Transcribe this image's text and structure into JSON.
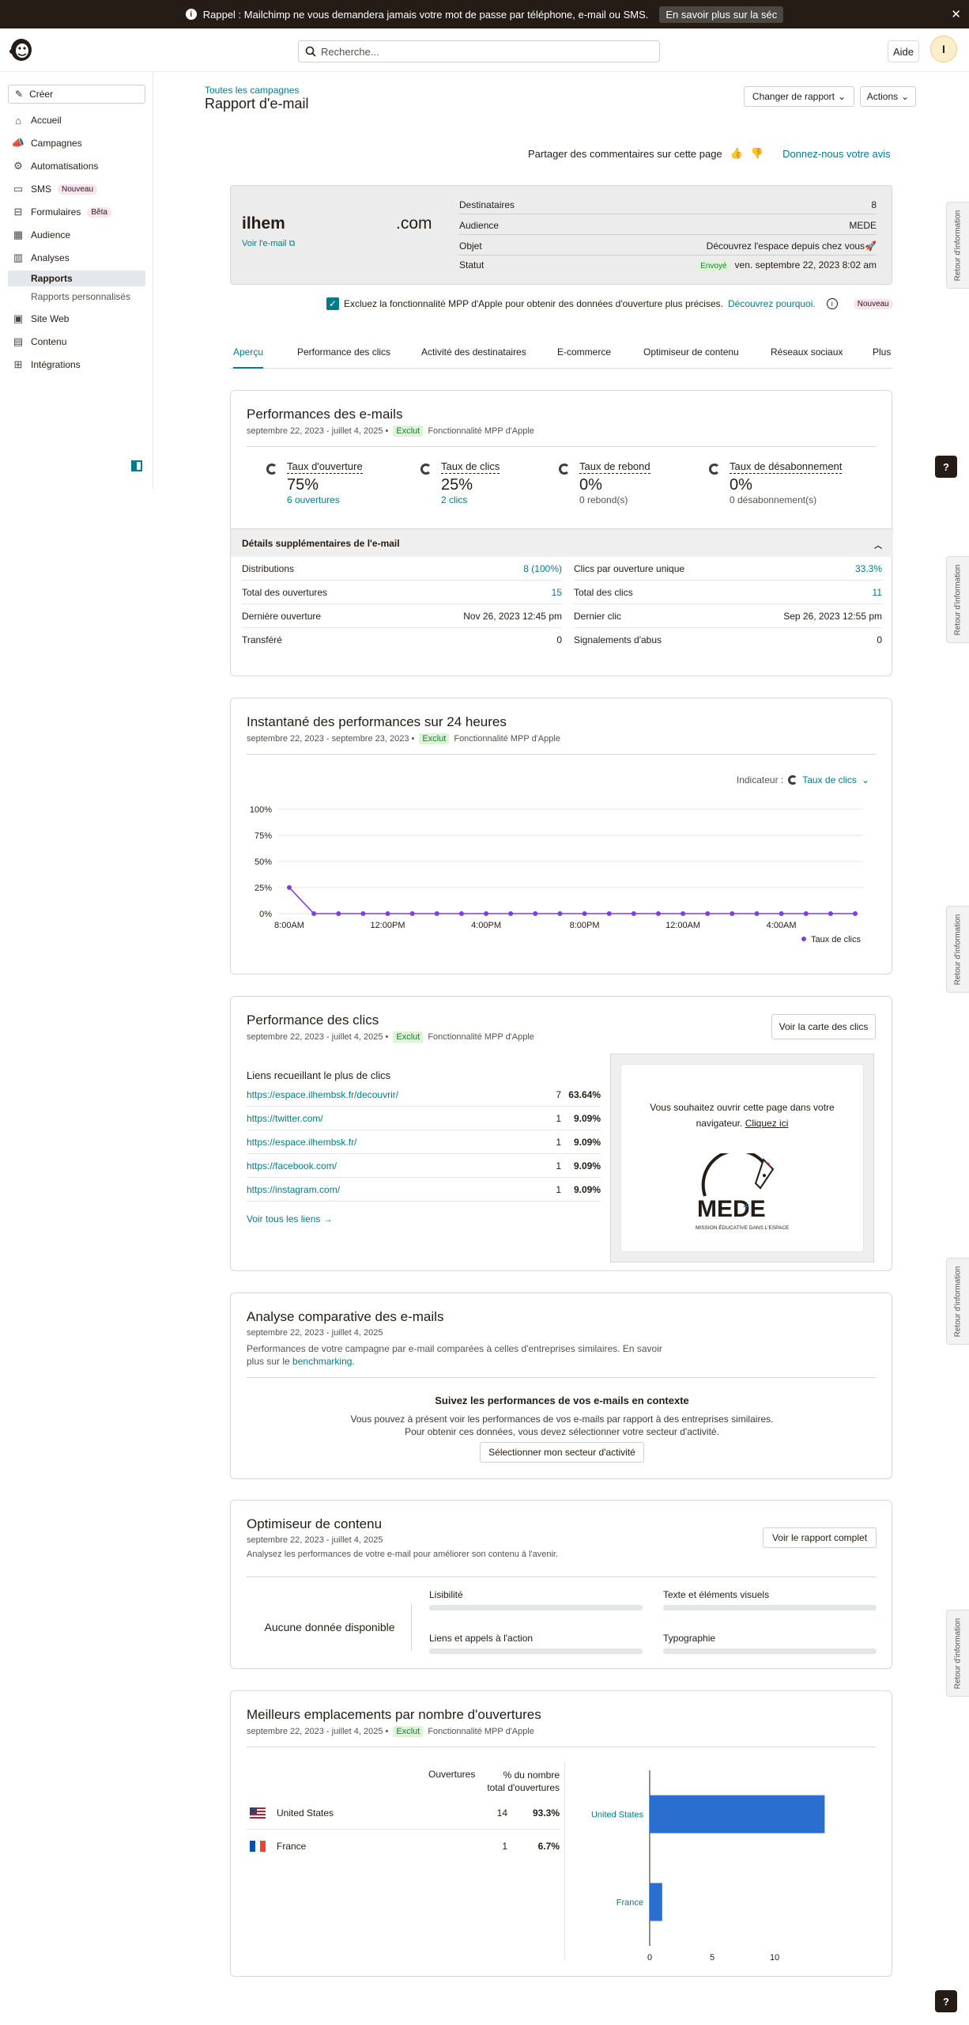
{
  "topbar": {
    "message": "Rappel : Mailchimp ne vous demandera jamais votre mot de passe par téléphone, e-mail ou SMS.",
    "learn_label": "En savoir plus sur la séc",
    "close": "✕"
  },
  "header": {
    "search_placeholder": "Recherche...",
    "help_label": "Aide",
    "avatar_initial": "I"
  },
  "sidebar": {
    "create_label": "Créer",
    "items": [
      {
        "label": "Accueil",
        "icon": "home-icon"
      },
      {
        "label": "Campagnes",
        "icon": "megaphone-icon"
      },
      {
        "label": "Automatisations",
        "icon": "automation-icon"
      },
      {
        "label": "SMS",
        "icon": "sms-icon",
        "badge": "Nouveau"
      },
      {
        "label": "Formulaires",
        "icon": "forms-icon",
        "badge": "Bêta"
      },
      {
        "label": "Audience",
        "icon": "audience-icon"
      },
      {
        "label": "Analyses",
        "icon": "analytics-icon"
      },
      {
        "label": "Site Web",
        "icon": "website-icon"
      },
      {
        "label": "Contenu",
        "icon": "content-icon"
      },
      {
        "label": "Intégrations",
        "icon": "integrations-icon"
      }
    ],
    "subitems": [
      "Rapports",
      "Rapports personnalisés"
    ]
  },
  "page": {
    "breadcrumb": "Toutes les campagnes",
    "title": "Rapport d'e-mail",
    "change_report": "Changer de rapport",
    "actions": "Actions",
    "feedback_text": "Partager des commentaires sur cette page",
    "feedback_link": "Donnez-nous votre avis"
  },
  "summary": {
    "from_name": "ilhem",
    "from_domain": ".com",
    "view_email": "Voir l'e-mail",
    "rows": [
      {
        "label": "Destinataires",
        "value": "8"
      },
      {
        "label": "Audience",
        "value": "MEDE"
      },
      {
        "label": "Objet",
        "value": "Découvrez l'espace depuis chez vous🚀"
      },
      {
        "label": "Statut",
        "badge": "Envoyé",
        "value": "ven. septembre 22, 2023 8:02 am"
      }
    ]
  },
  "mpp": {
    "text": "Excluez la fonctionnalité MPP d'Apple pour obtenir des données d'ouverture plus précises.",
    "link": "Découvrez pourquoi.",
    "badge": "Nouveau"
  },
  "tabs": [
    "Aperçu",
    "Performance des clics",
    "Activité des destinataires",
    "E-commerce",
    "Optimiseur de contenu",
    "Réseaux sociaux",
    "Plus"
  ],
  "perf": {
    "title": "Performances des e-mails",
    "dates": "septembre 22, 2023 - juillet 4, 2025 •",
    "excl": "Exclut",
    "mpp_label": "Fonctionnalité MPP d'Apple",
    "stats": [
      {
        "label": "Taux d'ouverture",
        "value": "75%",
        "sub": "6 ouvertures",
        "link": true
      },
      {
        "label": "Taux de clics",
        "value": "25%",
        "sub": "2 clics",
        "link": true
      },
      {
        "label": "Taux de rebond",
        "value": "0%",
        "sub": "0 rebond(s)",
        "link": false
      },
      {
        "label": "Taux de désabonnement",
        "value": "0%",
        "sub": "0 désabonnement(s)",
        "link": false
      }
    ],
    "details_title": "Détails supplémentaires de l'e-mail",
    "details_left": [
      {
        "label": "Distributions",
        "value": "8 (100%)",
        "link": true
      },
      {
        "label": "Total des ouvertures",
        "value": "15",
        "link": true
      },
      {
        "label": "Dernière ouverture",
        "value": "Nov 26, 2023 12:45 pm",
        "link": false
      },
      {
        "label": "Transféré",
        "value": "0",
        "link": false
      }
    ],
    "details_right": [
      {
        "label": "Clics par ouverture unique",
        "value": "33.3%",
        "link": true
      },
      {
        "label": "Total des clics",
        "value": "11",
        "link": true
      },
      {
        "label": "Dernier clic",
        "value": "Sep 26, 2023 12:55 pm",
        "link": false
      },
      {
        "label": "Signalements d'abus",
        "value": "0",
        "link": false
      }
    ]
  },
  "snapshot": {
    "title": "Instantané des performances sur 24 heures",
    "dates": "septembre 22, 2023 - septembre 23, 2023 •",
    "excl": "Exclut",
    "mpp_label": "Fonctionnalité MPP d'Apple",
    "indicator_label": "Indicateur :",
    "indicator_value": "Taux de clics",
    "legend": "Taux de clics"
  },
  "chart_data": {
    "type": "line",
    "title": "",
    "x_ticks": [
      "8:00AM",
      "12:00PM",
      "4:00PM",
      "8:00PM",
      "12:00AM",
      "4:00AM"
    ],
    "y_ticks": [
      "100%",
      "75%",
      "50%",
      "25%",
      "0%"
    ],
    "ylim": [
      0,
      100
    ],
    "series": [
      {
        "name": "Taux de clics",
        "color": "#7b3fe4",
        "values": [
          25,
          0,
          0,
          0,
          0,
          0,
          0,
          0,
          0,
          0,
          0,
          0,
          0,
          0,
          0,
          0,
          0,
          0,
          0,
          0,
          0,
          0,
          0,
          0
        ]
      }
    ],
    "grid": true,
    "legend": "bottom-right"
  },
  "clicks": {
    "title": "Performance des clics",
    "dates": "septembre 22, 2023 - juillet 4, 2025 •",
    "excl": "Exclut",
    "mpp_label": "Fonctionnalité MPP d'Apple",
    "map_button": "Voir la carte des clics",
    "links_title": "Liens recueillant le plus de clics",
    "links": [
      {
        "url": "https://espace.ilhembsk.fr/decouvrir/",
        "count": "7",
        "pct": "63.64%"
      },
      {
        "url": "https://twitter.com/",
        "count": "1",
        "pct": "9.09%"
      },
      {
        "url": "https://espace.ilhembsk.fr/",
        "count": "1",
        "pct": "9.09%"
      },
      {
        "url": "https://facebook.com/",
        "count": "1",
        "pct": "9.09%"
      },
      {
        "url": "https://instagram.com/",
        "count": "1",
        "pct": "9.09%"
      }
    ],
    "all_links": "Voir tous les liens",
    "preview_text": "Vous souhaitez ouvrir cette page dans votre navigateur.",
    "preview_link": "Cliquez ici",
    "logo_text": "MEDE",
    "logo_sub": "MISSION ÉDUCATIVE DANS L'ESPACE"
  },
  "bench": {
    "title": "Analyse comparative des e-mails",
    "dates": "septembre 22, 2023 - juillet 4, 2025",
    "desc": "Performances de votre campagne par e-mail comparées à celles d'entreprises similaires. En savoir plus sur le",
    "desc_link": "benchmarking",
    "ctx_title": "Suivez les performances de vos e-mails en contexte",
    "ctx_line1": "Vous pouvez à présent voir les performances de vos e-mails par rapport à des entreprises similaires.",
    "ctx_line2": "Pour obtenir ces données, vous devez sélectionner votre secteur d'activité.",
    "ctx_button": "Sélectionner mon secteur d'activité"
  },
  "optim": {
    "title": "Optimiseur de contenu",
    "dates": "septembre 22, 2023 - juillet 4, 2025",
    "desc": "Analysez les performances de votre e-mail pour améliorer son contenu à l'avenir.",
    "button": "Voir le rapport complet",
    "empty": "Aucune donnée disponible",
    "metrics": [
      "Lisibilité",
      "Texte et éléments visuels",
      "Liens et appels à l'action",
      "Typographie"
    ]
  },
  "locations": {
    "title": "Meilleurs emplacements par nombre d'ouvertures",
    "dates": "septembre 22, 2023 - juillet 4, 2025 •",
    "excl": "Exclut",
    "mpp_label": "Fonctionnalité MPP d'Apple",
    "col_opens": "Ouvertures",
    "col_pct_1": "% du nombre",
    "col_pct_2": "total d'ouvertures",
    "rows": [
      {
        "country": "United States",
        "flag": "us-flag-icon",
        "opens": "14",
        "pct": "93.3%",
        "value": 14
      },
      {
        "country": "France",
        "flag": "fr-flag-icon",
        "opens": "1",
        "pct": "6.7%",
        "value": 1
      }
    ],
    "x_ticks": [
      "0",
      "5",
      "10"
    ],
    "xlim": [
      0,
      14
    ],
    "bar_color": "#2a6ecf"
  },
  "feedback_tab": "Retour d'information",
  "help_button": "?"
}
